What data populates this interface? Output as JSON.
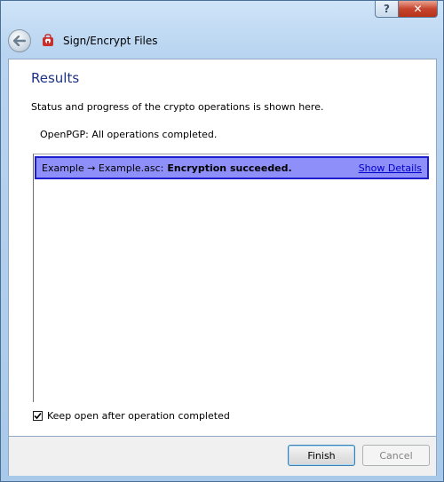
{
  "window": {
    "title": "Sign/Encrypt Files",
    "help_button_label": "?",
    "close_button_label": "✕"
  },
  "page": {
    "heading": "Results",
    "description": "Status and progress of the crypto operations is shown here.",
    "status": "OpenPGP: All operations completed."
  },
  "results": [
    {
      "operation": "Example → Example.asc:",
      "result": "Encryption succeeded.",
      "link": "Show Details"
    }
  ],
  "options": {
    "keep_open_label": "Keep open after operation completed",
    "keep_open_checked": true
  },
  "buttons": {
    "finish": "Finish",
    "cancel": "Cancel"
  },
  "colors": {
    "heading": "#1e3287",
    "selected_row_bg": "#8f8ffa",
    "selected_row_border": "#1d1dd0",
    "link": "#0000cc"
  }
}
